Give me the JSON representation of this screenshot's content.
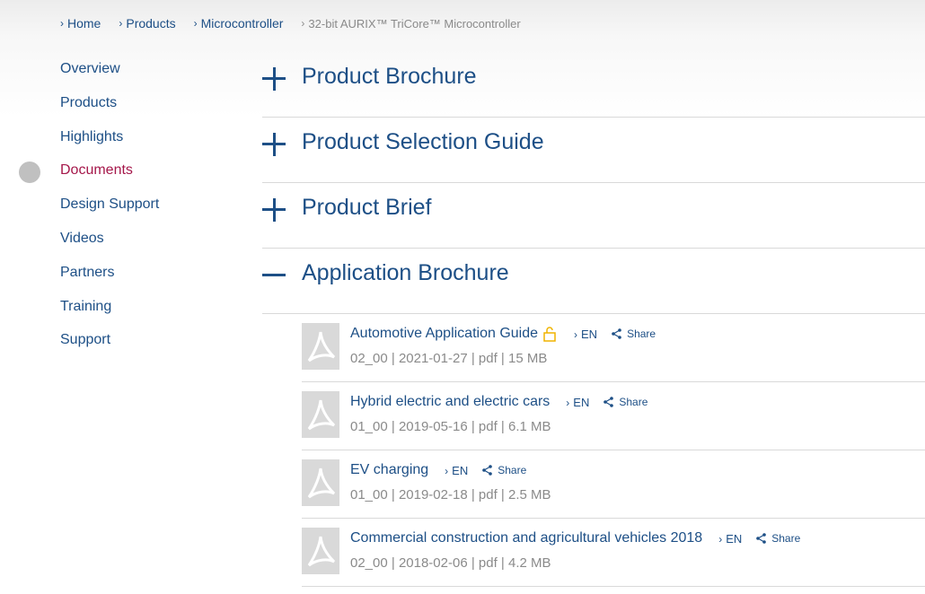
{
  "breadcrumb": {
    "items": [
      {
        "label": "Home"
      },
      {
        "label": "Products"
      },
      {
        "label": "Microcontroller"
      }
    ],
    "current": "32-bit AURIX™ TriCore™ Microcontroller"
  },
  "sidebar": {
    "items": [
      {
        "label": "Overview",
        "active": false
      },
      {
        "label": "Products",
        "active": false
      },
      {
        "label": "Highlights",
        "active": false
      },
      {
        "label": "Documents",
        "active": true
      },
      {
        "label": "Design Support",
        "active": false
      },
      {
        "label": "Videos",
        "active": false
      },
      {
        "label": "Partners",
        "active": false
      },
      {
        "label": "Training",
        "active": false
      },
      {
        "label": "Support",
        "active": false
      }
    ]
  },
  "sections": [
    {
      "title": "Product Brochure",
      "expanded": false
    },
    {
      "title": "Product Selection Guide",
      "expanded": false
    },
    {
      "title": "Product Brief",
      "expanded": false
    },
    {
      "title": "Application Brochure",
      "expanded": true
    }
  ],
  "documents": [
    {
      "title": "Automotive Application Guide",
      "locked": true,
      "lang": "EN",
      "share": "Share",
      "meta": "02_00 | 2021-01-27 | pdf | 15 MB"
    },
    {
      "title": "Hybrid electric and electric cars",
      "locked": false,
      "lang": "EN",
      "share": "Share",
      "meta": "01_00 | 2019-05-16 | pdf | 6.1 MB"
    },
    {
      "title": "EV charging",
      "locked": false,
      "lang": "EN",
      "share": "Share",
      "meta": "01_00 | 2019-02-18 | pdf | 2.5 MB"
    },
    {
      "title": "Commercial construction and agricultural vehicles 2018",
      "locked": false,
      "lang": "EN",
      "share": "Share",
      "meta": "02_00 | 2018-02-06 | pdf | 4.2 MB"
    }
  ],
  "colors": {
    "link": "#1d4f86",
    "active": "#a5174a",
    "muted": "#8a8a8a",
    "lock": "#f0b400"
  }
}
